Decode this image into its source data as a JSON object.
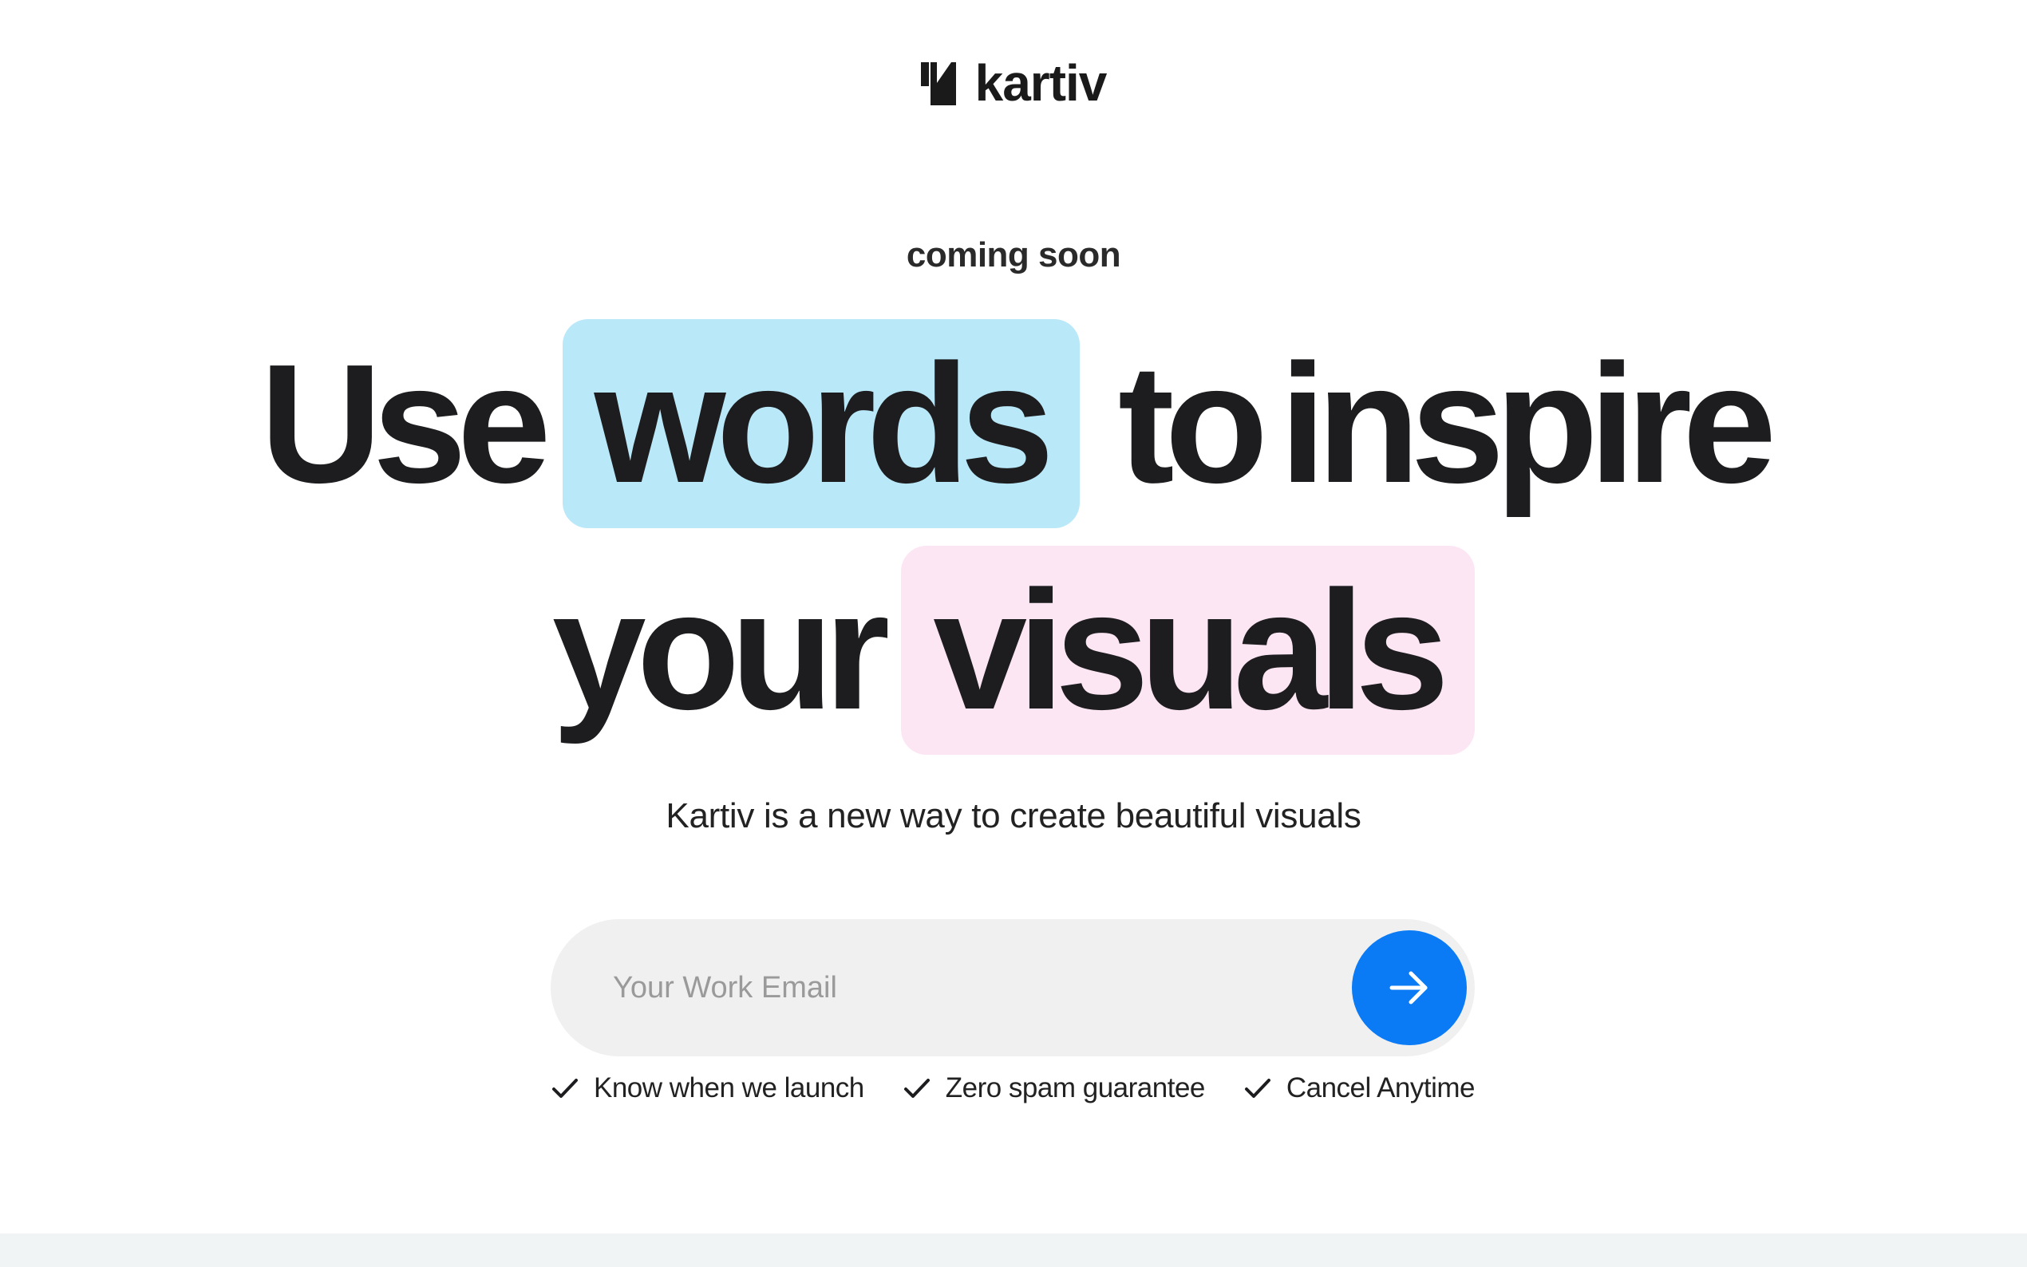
{
  "brand": {
    "name": "kartiv",
    "logo_icon": "kartiv-logomark-icon"
  },
  "hero": {
    "eyebrow": "coming soon",
    "headline": {
      "w1": "Use",
      "w2": "words",
      "w3": "to",
      "w4": "inspire",
      "w5": "your",
      "w6": "visuals"
    },
    "highlight_colors": {
      "words": "#b9e8f9",
      "visuals": "#fde6f3"
    },
    "subtitle": "Kartiv is a new way to create beautiful visuals"
  },
  "signup": {
    "email_placeholder": "Your Work Email",
    "email_value": "",
    "submit_icon": "arrow-right-icon",
    "accent_color": "#0a7bf5"
  },
  "benefits": [
    {
      "icon": "check-icon",
      "label": "Know when we launch"
    },
    {
      "icon": "check-icon",
      "label": "Zero spam guarantee"
    },
    {
      "icon": "check-icon",
      "label": "Cancel Anytime"
    }
  ]
}
